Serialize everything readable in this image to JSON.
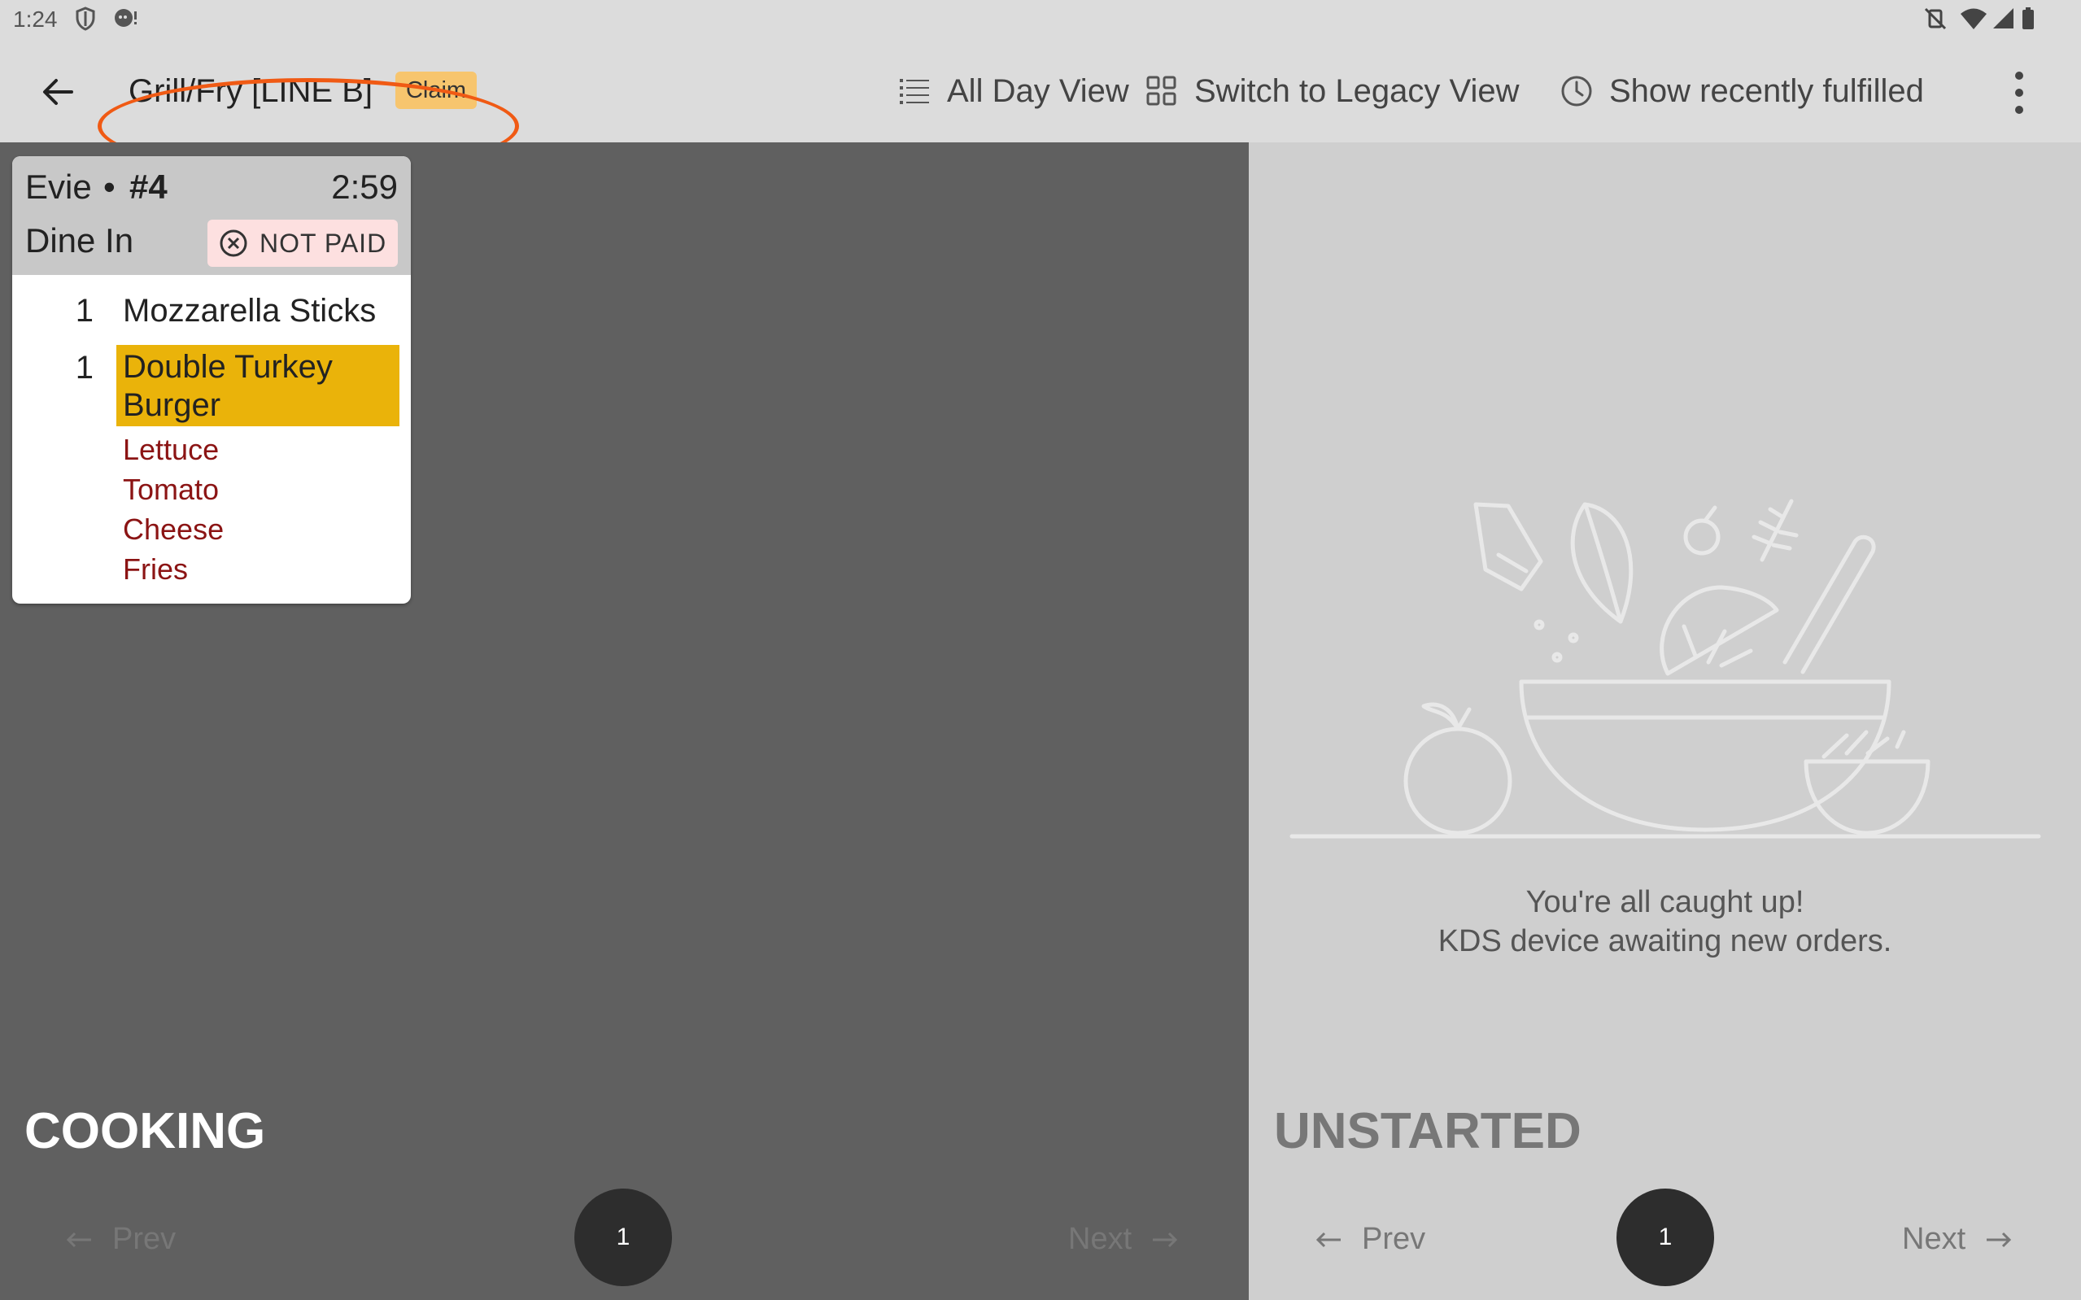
{
  "status_bar": {
    "time": "1:24",
    "left_icons": [
      "shield-icon",
      "chat-bubble-icon"
    ],
    "right_icons": [
      "mute-vibrate-icon",
      "wifi-icon",
      "cell-signal-icon",
      "battery-icon"
    ]
  },
  "app_bar": {
    "back_icon": "arrow-left-icon",
    "station_title": "Grill/Fry [LINE B]",
    "claim_label": "Claim",
    "actions": [
      {
        "icon": "list-icon",
        "label": "All Day View"
      },
      {
        "icon": "grid-icon",
        "label": "Switch to Legacy View"
      },
      {
        "icon": "clock-icon",
        "label": "Show recently fulfilled"
      }
    ],
    "more_icon": "more-vertical-icon"
  },
  "colors": {
    "annotation_ellipse": "#f05a14",
    "claim_badge": "#f7c56e",
    "item_highlight": "#eab30a",
    "modifier_text": "#8b1414",
    "not_paid_badge": "#fde0e0"
  },
  "cooking": {
    "title": "COOKING",
    "ticket": {
      "name": "Evie",
      "separator": "•",
      "number": "#4",
      "timer": "2:59",
      "order_type": "Dine In",
      "payment_status": "NOT PAID",
      "payment_icon": "x-circle-icon",
      "items": [
        {
          "qty": "1",
          "name": "Mozzarella Sticks"
        },
        {
          "qty": "1",
          "name": "Double Turkey Burger",
          "modifiers": [
            "Lettuce",
            "Tomato",
            "Cheese",
            "Fries"
          ]
        }
      ]
    },
    "pagination": {
      "prev": "Prev",
      "page": "1",
      "next": "Next"
    }
  },
  "unstarted": {
    "title": "UNSTARTED",
    "empty_illustration": "food-bowl-illustration",
    "empty_line1": "You're all caught up!",
    "empty_line2": "KDS device awaiting new orders.",
    "pagination": {
      "prev": "Prev",
      "page": "1",
      "next": "Next"
    }
  }
}
